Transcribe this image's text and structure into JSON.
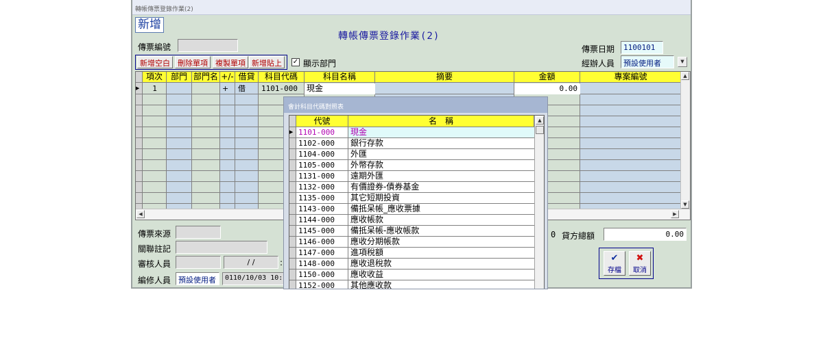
{
  "window": {
    "titlebar": "轉帳傳票登錄作業(2)",
    "mode": "新增",
    "form_title": "轉帳傳票登錄作業(2)"
  },
  "header": {
    "voucher_no_label": "傳票編號",
    "voucher_no_value": "",
    "voucher_date_label": "傳票日期",
    "voucher_date_value": "1100101",
    "handler_label": "經辦人員",
    "handler_value": "預設使用者"
  },
  "toolbar": {
    "add_blank": "新增空白",
    "delete_item": "刪除單項",
    "copy_item": "複製單項",
    "add_paste": "新增貼上",
    "show_dept_label": "顯示部門",
    "show_dept_checked": "✓"
  },
  "grid": {
    "columns": [
      "項次",
      "部門",
      "部門名",
      "+/-",
      "借貸",
      "科目代碼",
      "科目名稱",
      "摘要",
      "金額",
      "專案編號"
    ],
    "rows": [
      {
        "seq": "1",
        "dept": "",
        "dept_name": "",
        "sign": "+",
        "dc": "借",
        "code": "1101-000",
        "name": "現金",
        "memo": "",
        "amount": "0.00",
        "project": ""
      }
    ]
  },
  "footer": {
    "source_label": "傳票來源",
    "source_value": "",
    "relation_label": "關聯註記",
    "relation_value": "",
    "reviewer_label": "審核人員",
    "reviewer_value": "",
    "review_date_value": "/ /",
    "review_time_value": ":",
    "editor_label": "編修人員",
    "editor_value": "預設使用者",
    "edit_time_value": "0110/10/03 10:",
    "debit_total_tail": "0",
    "credit_total_label": "貸方總額",
    "credit_total_value": "0.00"
  },
  "actions": {
    "save": "存檔",
    "cancel": "取消",
    "save_icon": "save-check-icon",
    "cancel_icon": "cancel-x-icon"
  },
  "lookup": {
    "title": "會計科目代碼對照表",
    "col_code": "代號",
    "col_name": "名　稱",
    "rows": [
      {
        "code": "1101-000",
        "name": "現金"
      },
      {
        "code": "1102-000",
        "name": "銀行存款"
      },
      {
        "code": "1104-000",
        "name": "外匯"
      },
      {
        "code": "1105-000",
        "name": "外幣存款"
      },
      {
        "code": "1131-000",
        "name": "遠期外匯"
      },
      {
        "code": "1132-000",
        "name": "有價證券-債券基金"
      },
      {
        "code": "1135-000",
        "name": "其它短期投資"
      },
      {
        "code": "1143-000",
        "name": "備抵呆帳_應收票據"
      },
      {
        "code": "1144-000",
        "name": "應收帳款"
      },
      {
        "code": "1145-000",
        "name": "備抵呆帳-應收帳款"
      },
      {
        "code": "1146-000",
        "name": "應收分期帳款"
      },
      {
        "code": "1147-000",
        "name": "進項稅額"
      },
      {
        "code": "1148-000",
        "name": "應收退稅款"
      },
      {
        "code": "1150-000",
        "name": "應收收益"
      },
      {
        "code": "1152-000",
        "name": "其他應收款"
      }
    ]
  }
}
